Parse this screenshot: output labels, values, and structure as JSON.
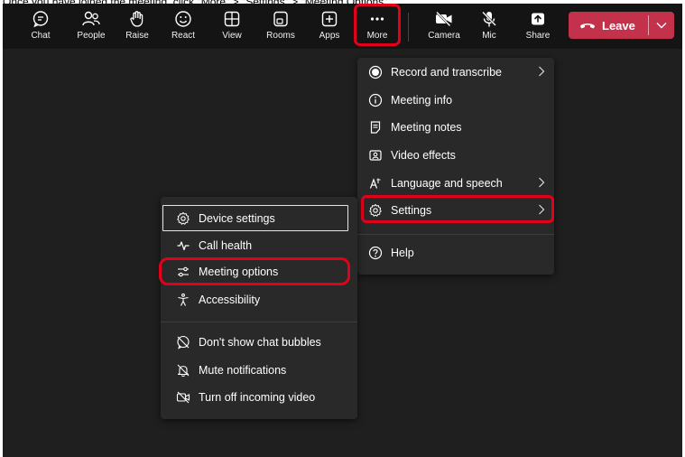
{
  "caption": "Once you have joined the meeting, click \"More\" > \"Settings\" > \"Meeting Options\"",
  "toolbar": {
    "buttons": [
      {
        "icon": "chat-icon",
        "label": "Chat"
      },
      {
        "icon": "people-icon",
        "label": "People"
      },
      {
        "icon": "raise-hand-icon",
        "label": "Raise"
      },
      {
        "icon": "react-icon",
        "label": "React"
      },
      {
        "icon": "view-icon",
        "label": "View"
      },
      {
        "icon": "rooms-icon",
        "label": "Rooms"
      },
      {
        "icon": "apps-icon",
        "label": "Apps"
      },
      {
        "icon": "more-icon",
        "label": "More"
      },
      {
        "icon": "camera-off-icon",
        "label": "Camera"
      },
      {
        "icon": "mic-off-icon",
        "label": "Mic"
      },
      {
        "icon": "share-icon",
        "label": "Share"
      }
    ],
    "leave_label": "Leave"
  },
  "more_menu": {
    "items": [
      {
        "icon": "record-icon",
        "label": "Record and transcribe",
        "has_submenu": true
      },
      {
        "icon": "info-icon",
        "label": "Meeting info",
        "has_submenu": false
      },
      {
        "icon": "notes-icon",
        "label": "Meeting notes",
        "has_submenu": false
      },
      {
        "icon": "video-effects-icon",
        "label": "Video effects",
        "has_submenu": false
      },
      {
        "icon": "language-icon",
        "label": "Language and speech",
        "has_submenu": true
      },
      {
        "icon": "gear-icon",
        "label": "Settings",
        "has_submenu": true
      },
      {
        "icon": "help-icon",
        "label": "Help",
        "has_submenu": false
      }
    ]
  },
  "settings_menu": {
    "items": [
      {
        "icon": "gear-icon",
        "label": "Device settings"
      },
      {
        "icon": "call-health-icon",
        "label": "Call health"
      },
      {
        "icon": "sliders-icon",
        "label": "Meeting options"
      },
      {
        "icon": "accessibility-icon",
        "label": "Accessibility"
      },
      {
        "icon": "chat-bubble-off-icon",
        "label": "Don't show chat bubbles"
      },
      {
        "icon": "bell-off-icon",
        "label": "Mute notifications"
      },
      {
        "icon": "video-off-icon",
        "label": "Turn off incoming video"
      }
    ]
  },
  "colors": {
    "toolbar_bg": "#141414",
    "stage_bg": "#1f1f1f",
    "menu_bg": "#292929",
    "leave_red": "#c4314b",
    "highlight_ring": "#e3001b"
  }
}
